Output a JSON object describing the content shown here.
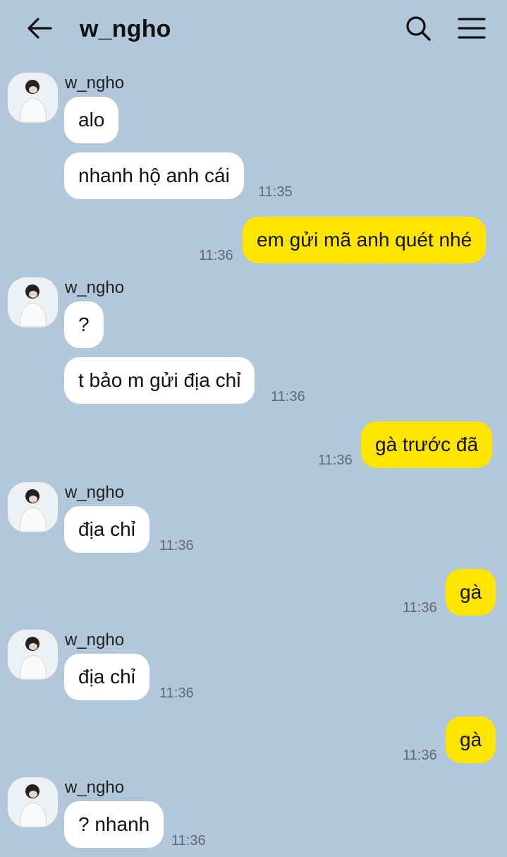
{
  "header": {
    "back_icon": "arrow-left-icon",
    "title": "w_ngho",
    "search_icon": "search-icon",
    "menu_icon": "hamburger-menu-icon"
  },
  "colors": {
    "background": "#b2c7d9",
    "incoming_bubble": "#ffffff",
    "outgoing_bubble": "#fee500"
  },
  "messages": [
    {
      "direction": "in",
      "sender": "w_ngho",
      "text": "alo",
      "time": ""
    },
    {
      "direction": "in",
      "text": "nhanh hộ anh cái",
      "time": "11:35"
    },
    {
      "direction": "out",
      "text": "em gửi mã anh quét nhé",
      "time": "11:36"
    },
    {
      "direction": "in",
      "sender": "w_ngho",
      "text": "?",
      "time": ""
    },
    {
      "direction": "in",
      "text": "t bảo m gửi địa chỉ",
      "time": "11:36"
    },
    {
      "direction": "out",
      "text": "gà trước đã",
      "time": "11:36"
    },
    {
      "direction": "in",
      "sender": "w_ngho",
      "text": "địa chỉ",
      "time": "11:36"
    },
    {
      "direction": "out",
      "text": "gà",
      "time": "11:36"
    },
    {
      "direction": "in",
      "sender": "w_ngho",
      "text": "địa chỉ",
      "time": "11:36"
    },
    {
      "direction": "out",
      "text": "gà",
      "time": "11:36"
    },
    {
      "direction": "in",
      "sender": "w_ngho",
      "text": "? nhanh",
      "time": "11:36"
    }
  ]
}
